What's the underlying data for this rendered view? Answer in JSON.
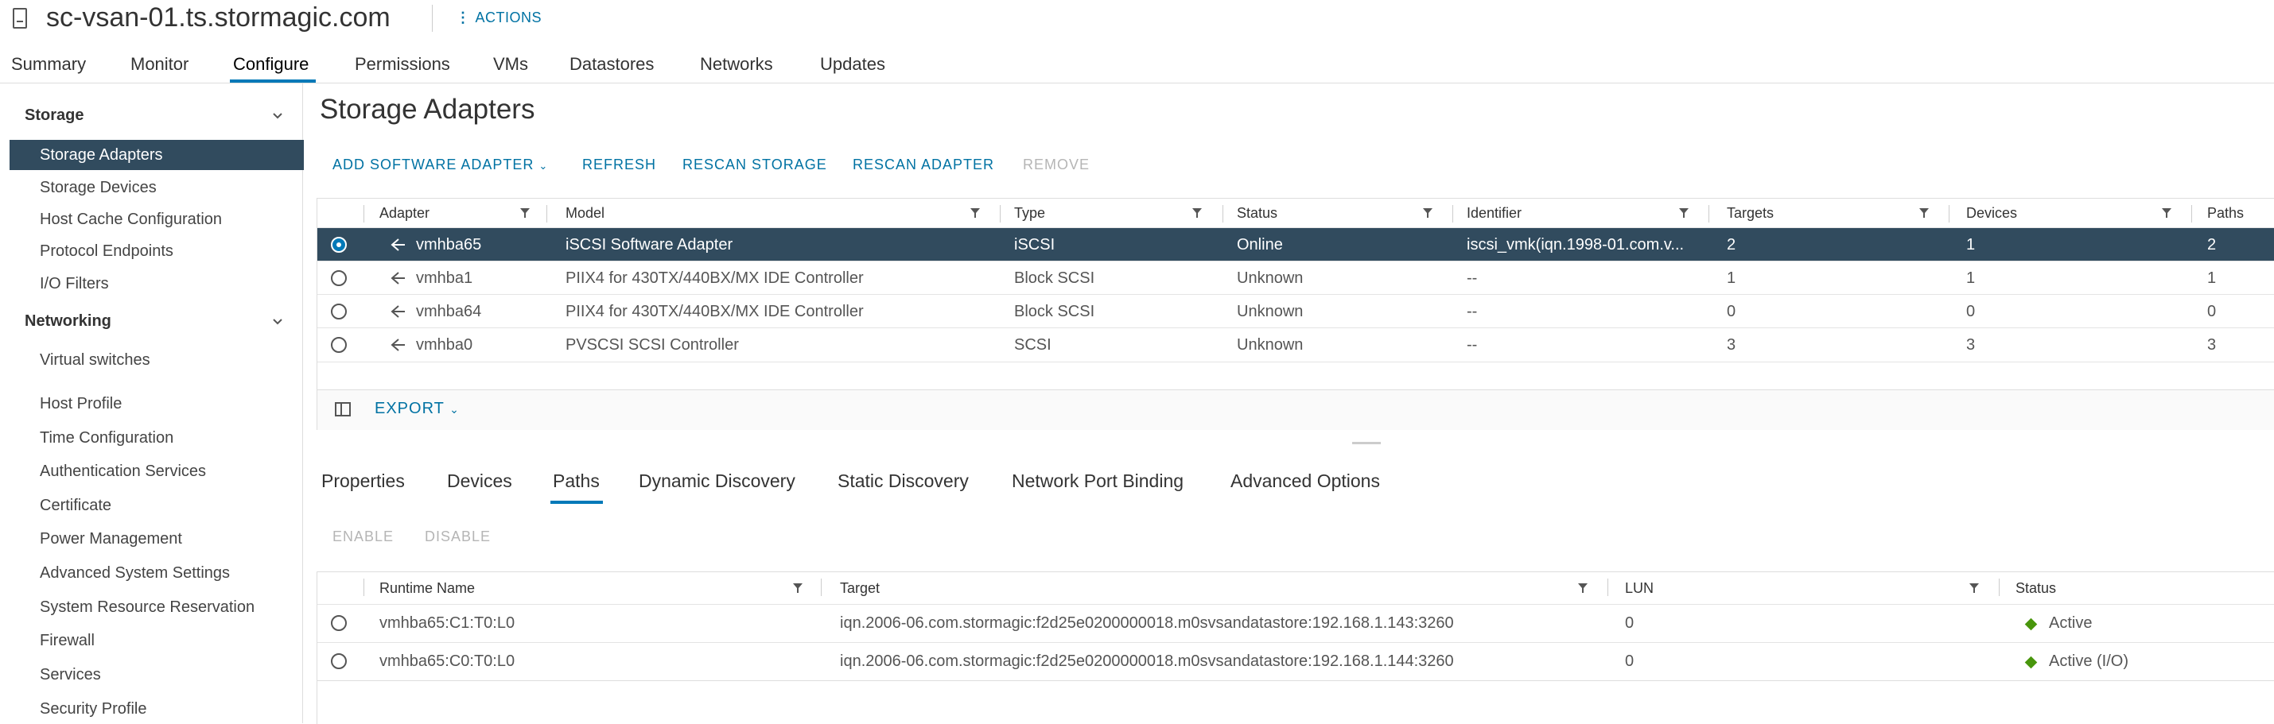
{
  "header": {
    "title": "sc-vsan-01.ts.stormagic.com",
    "actions_label": "ACTIONS"
  },
  "top_tabs": [
    "Summary",
    "Monitor",
    "Configure",
    "Permissions",
    "VMs",
    "Datastores",
    "Networks",
    "Updates"
  ],
  "top_tabs_active": "Configure",
  "sidebar": {
    "sections": [
      {
        "label": "Storage",
        "items": [
          "Storage Adapters",
          "Storage Devices",
          "Host Cache Configuration",
          "Protocol Endpoints",
          "I/O Filters"
        ]
      },
      {
        "label": "Networking",
        "items": [
          "Virtual switches"
        ]
      }
    ],
    "other_items": [
      "Host Profile",
      "Time Configuration",
      "Authentication Services",
      "Certificate",
      "Power Management",
      "Advanced System Settings",
      "System Resource Reservation",
      "Firewall",
      "Services",
      "Security Profile"
    ],
    "active_item": "Storage Adapters"
  },
  "main": {
    "title": "Storage Adapters",
    "toolbar": {
      "add_software_adapter": "ADD SOFTWARE ADAPTER",
      "refresh": "REFRESH",
      "rescan_storage": "RESCAN STORAGE",
      "rescan_adapter": "RESCAN ADAPTER",
      "remove": "REMOVE"
    },
    "adapters_table": {
      "columns": [
        "Adapter",
        "Model",
        "Type",
        "Status",
        "Identifier",
        "Targets",
        "Devices",
        "Paths"
      ],
      "rows": [
        {
          "selected": true,
          "adapter": "vmhba65",
          "model": "iSCSI Software Adapter",
          "type": "iSCSI",
          "status": "Online",
          "identifier": "iscsi_vmk(iqn.1998-01.com.v...",
          "targets": "2",
          "devices": "1",
          "paths": "2"
        },
        {
          "selected": false,
          "adapter": "vmhba1",
          "model": "PIIX4 for 430TX/440BX/MX IDE Controller",
          "type": "Block SCSI",
          "status": "Unknown",
          "identifier": "--",
          "targets": "1",
          "devices": "1",
          "paths": "1"
        },
        {
          "selected": false,
          "adapter": "vmhba64",
          "model": "PIIX4 for 430TX/440BX/MX IDE Controller",
          "type": "Block SCSI",
          "status": "Unknown",
          "identifier": "--",
          "targets": "0",
          "devices": "0",
          "paths": "0"
        },
        {
          "selected": false,
          "adapter": "vmhba0",
          "model": "PVSCSI SCSI Controller",
          "type": "SCSI",
          "status": "Unknown",
          "identifier": "--",
          "targets": "3",
          "devices": "3",
          "paths": "3"
        }
      ],
      "export_label": "EXPORT"
    },
    "sub_tabs": [
      "Properties",
      "Devices",
      "Paths",
      "Dynamic Discovery",
      "Static Discovery",
      "Network Port Binding",
      "Advanced Options"
    ],
    "sub_tabs_active": "Paths",
    "paths_toolbar": {
      "enable": "ENABLE",
      "disable": "DISABLE"
    },
    "paths_table": {
      "columns": [
        "Runtime Name",
        "Target",
        "LUN",
        "Status"
      ],
      "rows": [
        {
          "runtime_name": "vmhba65:C1:T0:L0",
          "target": "iqn.2006-06.com.stormagic:f2d25e0200000018.m0svsandatastore:192.168.1.143:3260",
          "lun": "0",
          "status": "Active"
        },
        {
          "runtime_name": "vmhba65:C0:T0:L0",
          "target": "iqn.2006-06.com.stormagic:f2d25e0200000018.m0svsandatastore:192.168.1.144:3260",
          "lun": "0",
          "status": "Active (I/O)"
        }
      ]
    }
  },
  "colors": {
    "accent": "#0079b8",
    "link": "#0072a3",
    "selected_row": "#314b5e",
    "status_active": "#48960c"
  }
}
